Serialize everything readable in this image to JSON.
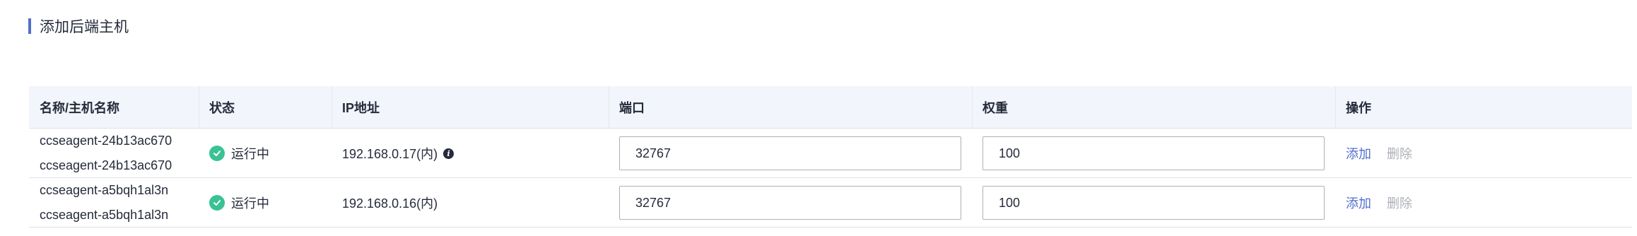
{
  "section": {
    "title": "添加后端主机"
  },
  "table": {
    "headers": {
      "name": "名称/主机名称",
      "status": "状态",
      "ip": "IP地址",
      "port": "端口",
      "weight": "权重",
      "action": "操作"
    },
    "rows": [
      {
        "name": "ccseagent-24b13ac670",
        "hostname": "ccseagent-24b13ac670",
        "status": "运行中",
        "ip": "192.168.0.17(内)",
        "port": "32767",
        "weight": "100",
        "add_label": "添加",
        "delete_label": "删除"
      },
      {
        "name": "ccseagent-a5bqh1al3n",
        "hostname": "ccseagent-a5bqh1al3n",
        "status": "运行中",
        "ip": "192.168.0.16(内)",
        "port": "32767",
        "weight": "100",
        "add_label": "添加",
        "delete_label": "删除"
      }
    ]
  },
  "colors": {
    "accent": "#526ecc",
    "status_running": "#3ac295",
    "header_bg": "#f2f5fc"
  }
}
